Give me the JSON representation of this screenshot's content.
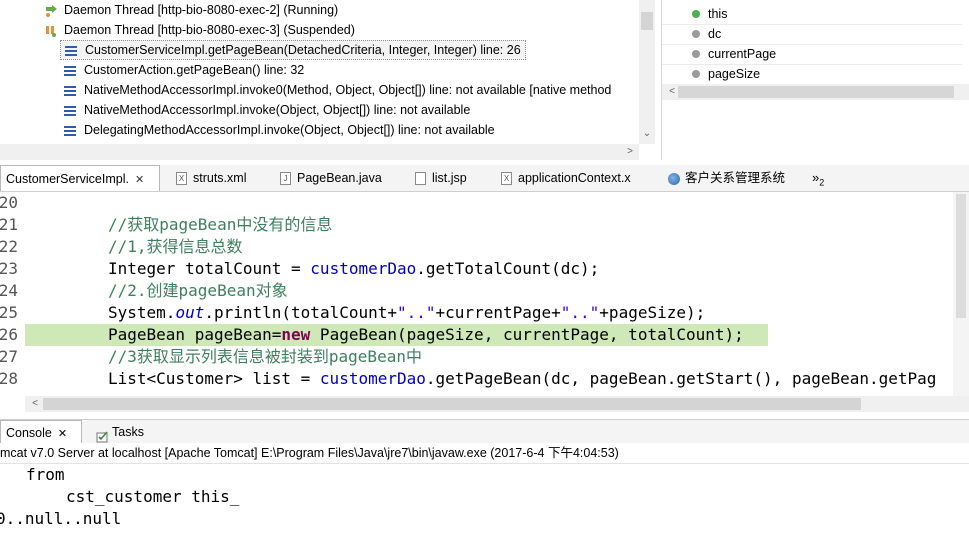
{
  "debug": {
    "threads": [
      {
        "label": "Daemon Thread [http-bio-8080-exec-2] (Running)",
        "icon": "running-thread-icon"
      },
      {
        "label": "Daemon Thread [http-bio-8080-exec-3] (Suspended)",
        "icon": "suspended-thread-icon"
      }
    ],
    "frames": [
      "CustomerServiceImpl.getPageBean(DetachedCriteria, Integer, Integer) line: 26",
      "CustomerAction.getPageBean() line: 32",
      "NativeMethodAccessorImpl.invoke0(Method, Object, Object[]) line: not available [native method",
      "NativeMethodAccessorImpl.invoke(Object, Object[]) line: not available",
      "DelegatingMethodAccessorImpl.invoke(Object, Object[]) line: not available"
    ]
  },
  "variables": [
    {
      "name": "this",
      "color": "#4caf50"
    },
    {
      "name": "dc",
      "color": "#8a8a8a"
    },
    {
      "name": "currentPage",
      "color": "#8a8a8a"
    },
    {
      "name": "pageSize",
      "color": "#8a8a8a"
    }
  ],
  "editor_tabs": {
    "tab1": "CustomerServiceImpl.",
    "tab2": "struts.xml",
    "tab3": "PageBean.java",
    "tab4": "list.jsp",
    "tab5": "applicationContext.x",
    "tab6": "客户关系管理系统",
    "overflow": "»",
    "overflow_count": "2"
  },
  "editor": {
    "lines": {
      "n20": "20",
      "n21": "21",
      "n22": "22",
      "n23": "23",
      "n24": "24",
      "n25": "25",
      "n26": "26",
      "n27": "27",
      "n28": "28",
      "l21": "//获取pageBean中没有的信息",
      "l22": "//1,获得信息总数",
      "l23a": "Integer totalCount = ",
      "l23b": "customerDao",
      "l23c": ".getTotalCount(dc);",
      "l24": "//2.创建pageBean对象",
      "l25a": "System.",
      "l25b": "out",
      "l25c": ".println(totalCount+",
      "l25d": "\"..\"",
      "l25e": "+currentPage+",
      "l25f": "\"..\"",
      "l25g": "+pageSize);",
      "l26a": "PageBean pageBean=",
      "l26b": "new",
      "l26c": " PageBean(pageSize, currentPage, totalCount);",
      "l27": "//3获取显示列表信息被封装到pageBean中",
      "l28a": "List<Customer> list = ",
      "l28b": "customerDao",
      "l28c": ".getPageBean(dc, pageBean.getStart(), pageBean.getPag"
    }
  },
  "console": {
    "tab_console": "Console",
    "tab_tasks": "Tasks",
    "header": "mcat v7.0 Server at localhost [Apache Tomcat] E:\\Program Files\\Java\\jre7\\bin\\javaw.exe (2017-6-4 下午4:04:53)",
    "out1": "from",
    "out2": "cst_customer this_",
    "out3": "0..null..null"
  }
}
